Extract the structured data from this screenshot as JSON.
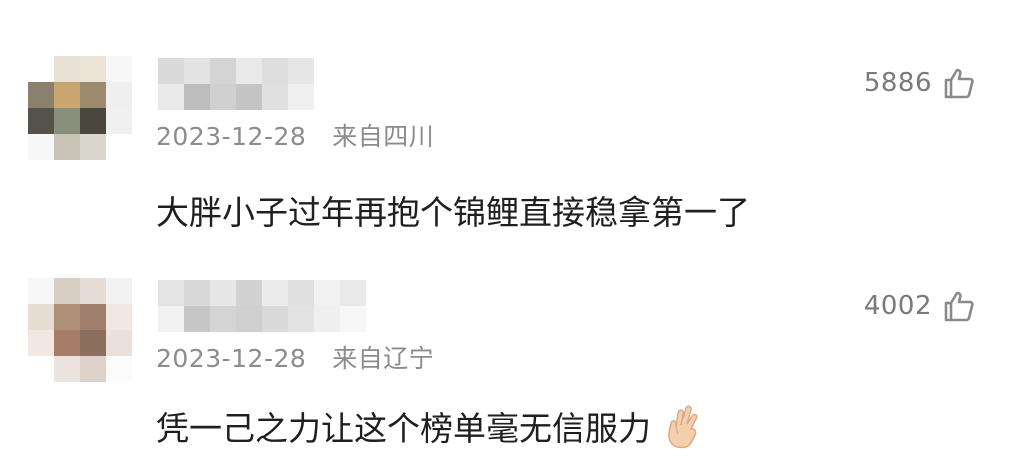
{
  "comments": [
    {
      "date": "2023-12-28",
      "location": "来自四川",
      "likes": "5886",
      "text": "大胖小子过年再抱个锦鲤直接稳拿第一了",
      "avatar": "blurred-avatar",
      "username": "blurred-username"
    },
    {
      "date": "2023-12-28",
      "location": "来自辽宁",
      "likes": "4002",
      "text": "凭一己之力让这个榜单毫无信服力",
      "emoji": "crossed-fingers-emoji",
      "avatar": "blurred-avatar",
      "username": "blurred-username"
    }
  ],
  "icons": {
    "like": "thumbs-up-outline-icon"
  },
  "colors": {
    "meta_text": "#8c8c8c",
    "body_text": "#1f1f1f",
    "likes_text": "#7a7a7a",
    "background": "#ffffff"
  }
}
